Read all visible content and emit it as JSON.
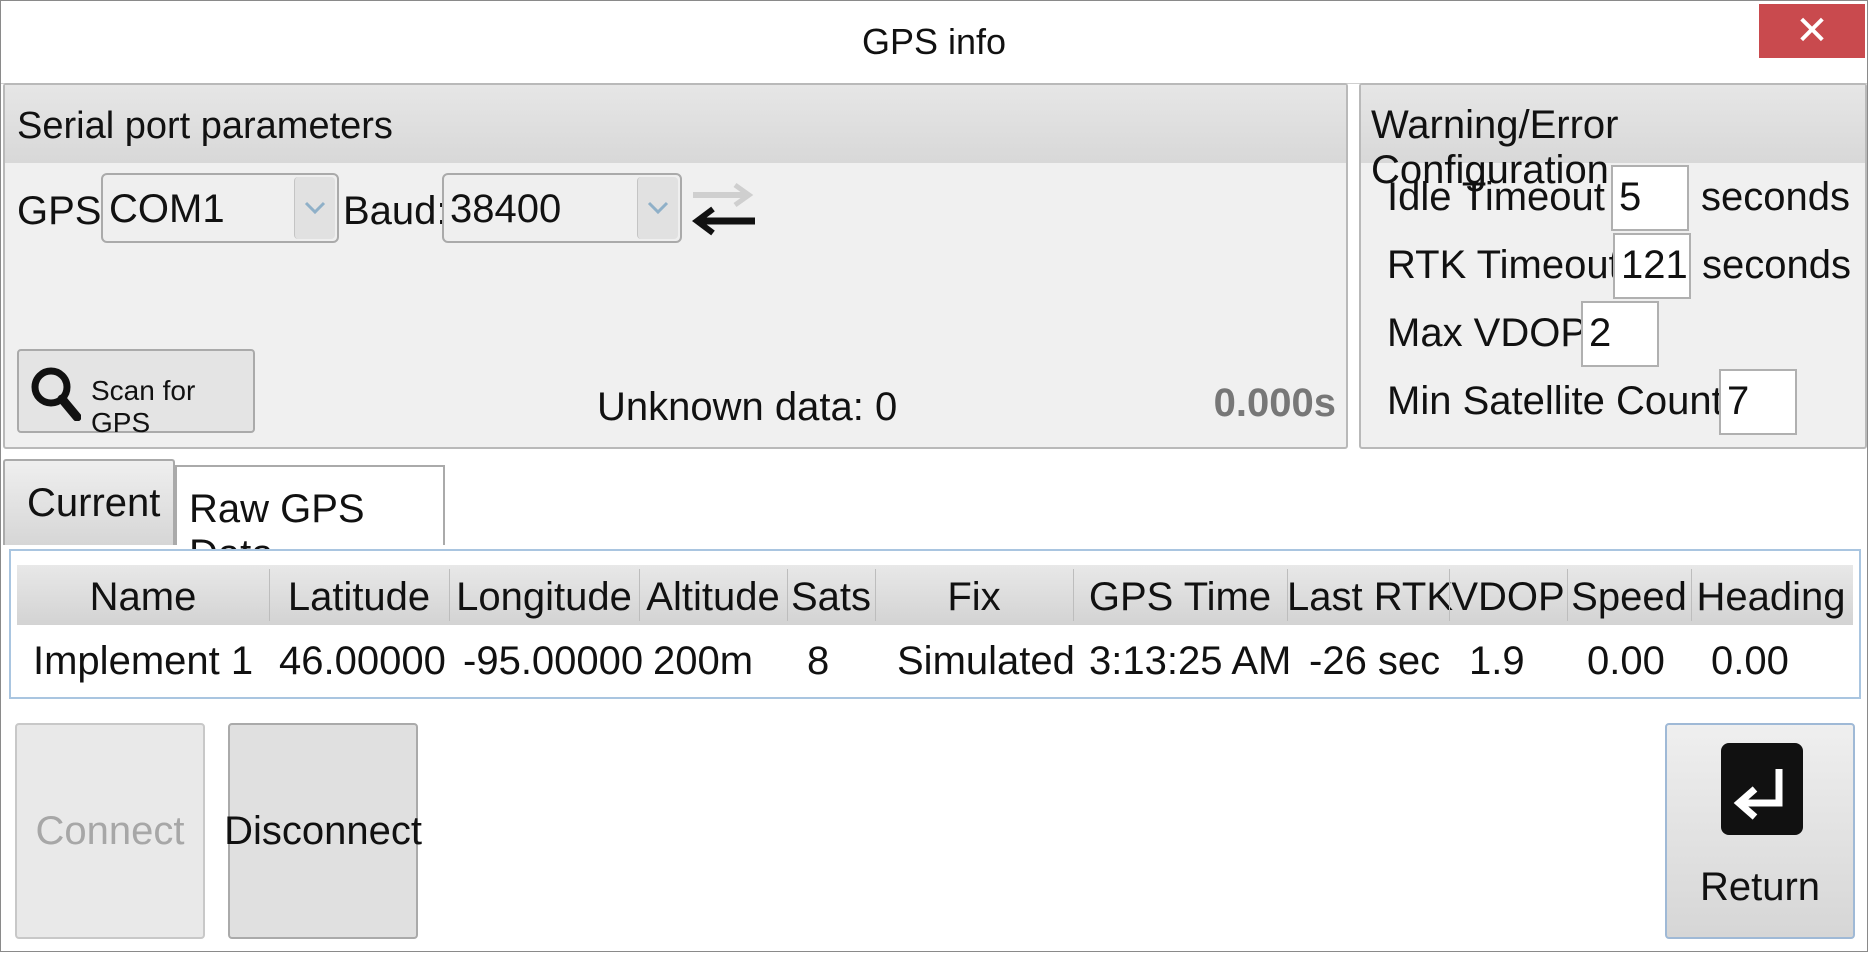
{
  "window": {
    "title": "GPS info",
    "close_label": "✕"
  },
  "serial": {
    "header": "Serial port parameters",
    "gps_label": "GPS",
    "gps_port": "COM1",
    "baud_label": "Baud:",
    "baud_value": "38400",
    "scan_label": "Scan for GPS",
    "unknown_data": "Unknown data: 0",
    "elapsed": "0.000s"
  },
  "warnings": {
    "header": "Warning/Error Configuration",
    "idle_label": "Idle Timeout",
    "idle_value": "5",
    "idle_unit": "seconds",
    "rtk_label": "RTK Timeout",
    "rtk_value": "121",
    "rtk_unit": "seconds",
    "vdop_label": "Max VDOP",
    "vdop_value": "2",
    "sat_label": "Min Satellite Count",
    "sat_value": "7"
  },
  "tabs": [
    {
      "label": "Current"
    },
    {
      "label": "Raw GPS Data"
    }
  ],
  "table": {
    "columns": [
      "Name",
      "Latitude",
      "Longitude",
      "Altitude",
      "Sats",
      "Fix",
      "GPS Time",
      "Last RTK",
      "VDOP",
      "Speed",
      "Heading"
    ],
    "rows": [
      [
        "Implement 1",
        "46.00000",
        "-95.00000",
        "200m",
        "8",
        "Simulated",
        "3:13:25 AM",
        "-26 sec",
        "1.9",
        "0.00",
        "0.00"
      ]
    ]
  },
  "buttons": {
    "connect": "Connect",
    "disconnect": "Disconnect",
    "return": "Return"
  },
  "icons": {
    "dropdown": "chevron-down-icon",
    "swap": "swap-arrows-icon",
    "scan": "magnifier-icon",
    "return": "return-arrow-icon"
  }
}
